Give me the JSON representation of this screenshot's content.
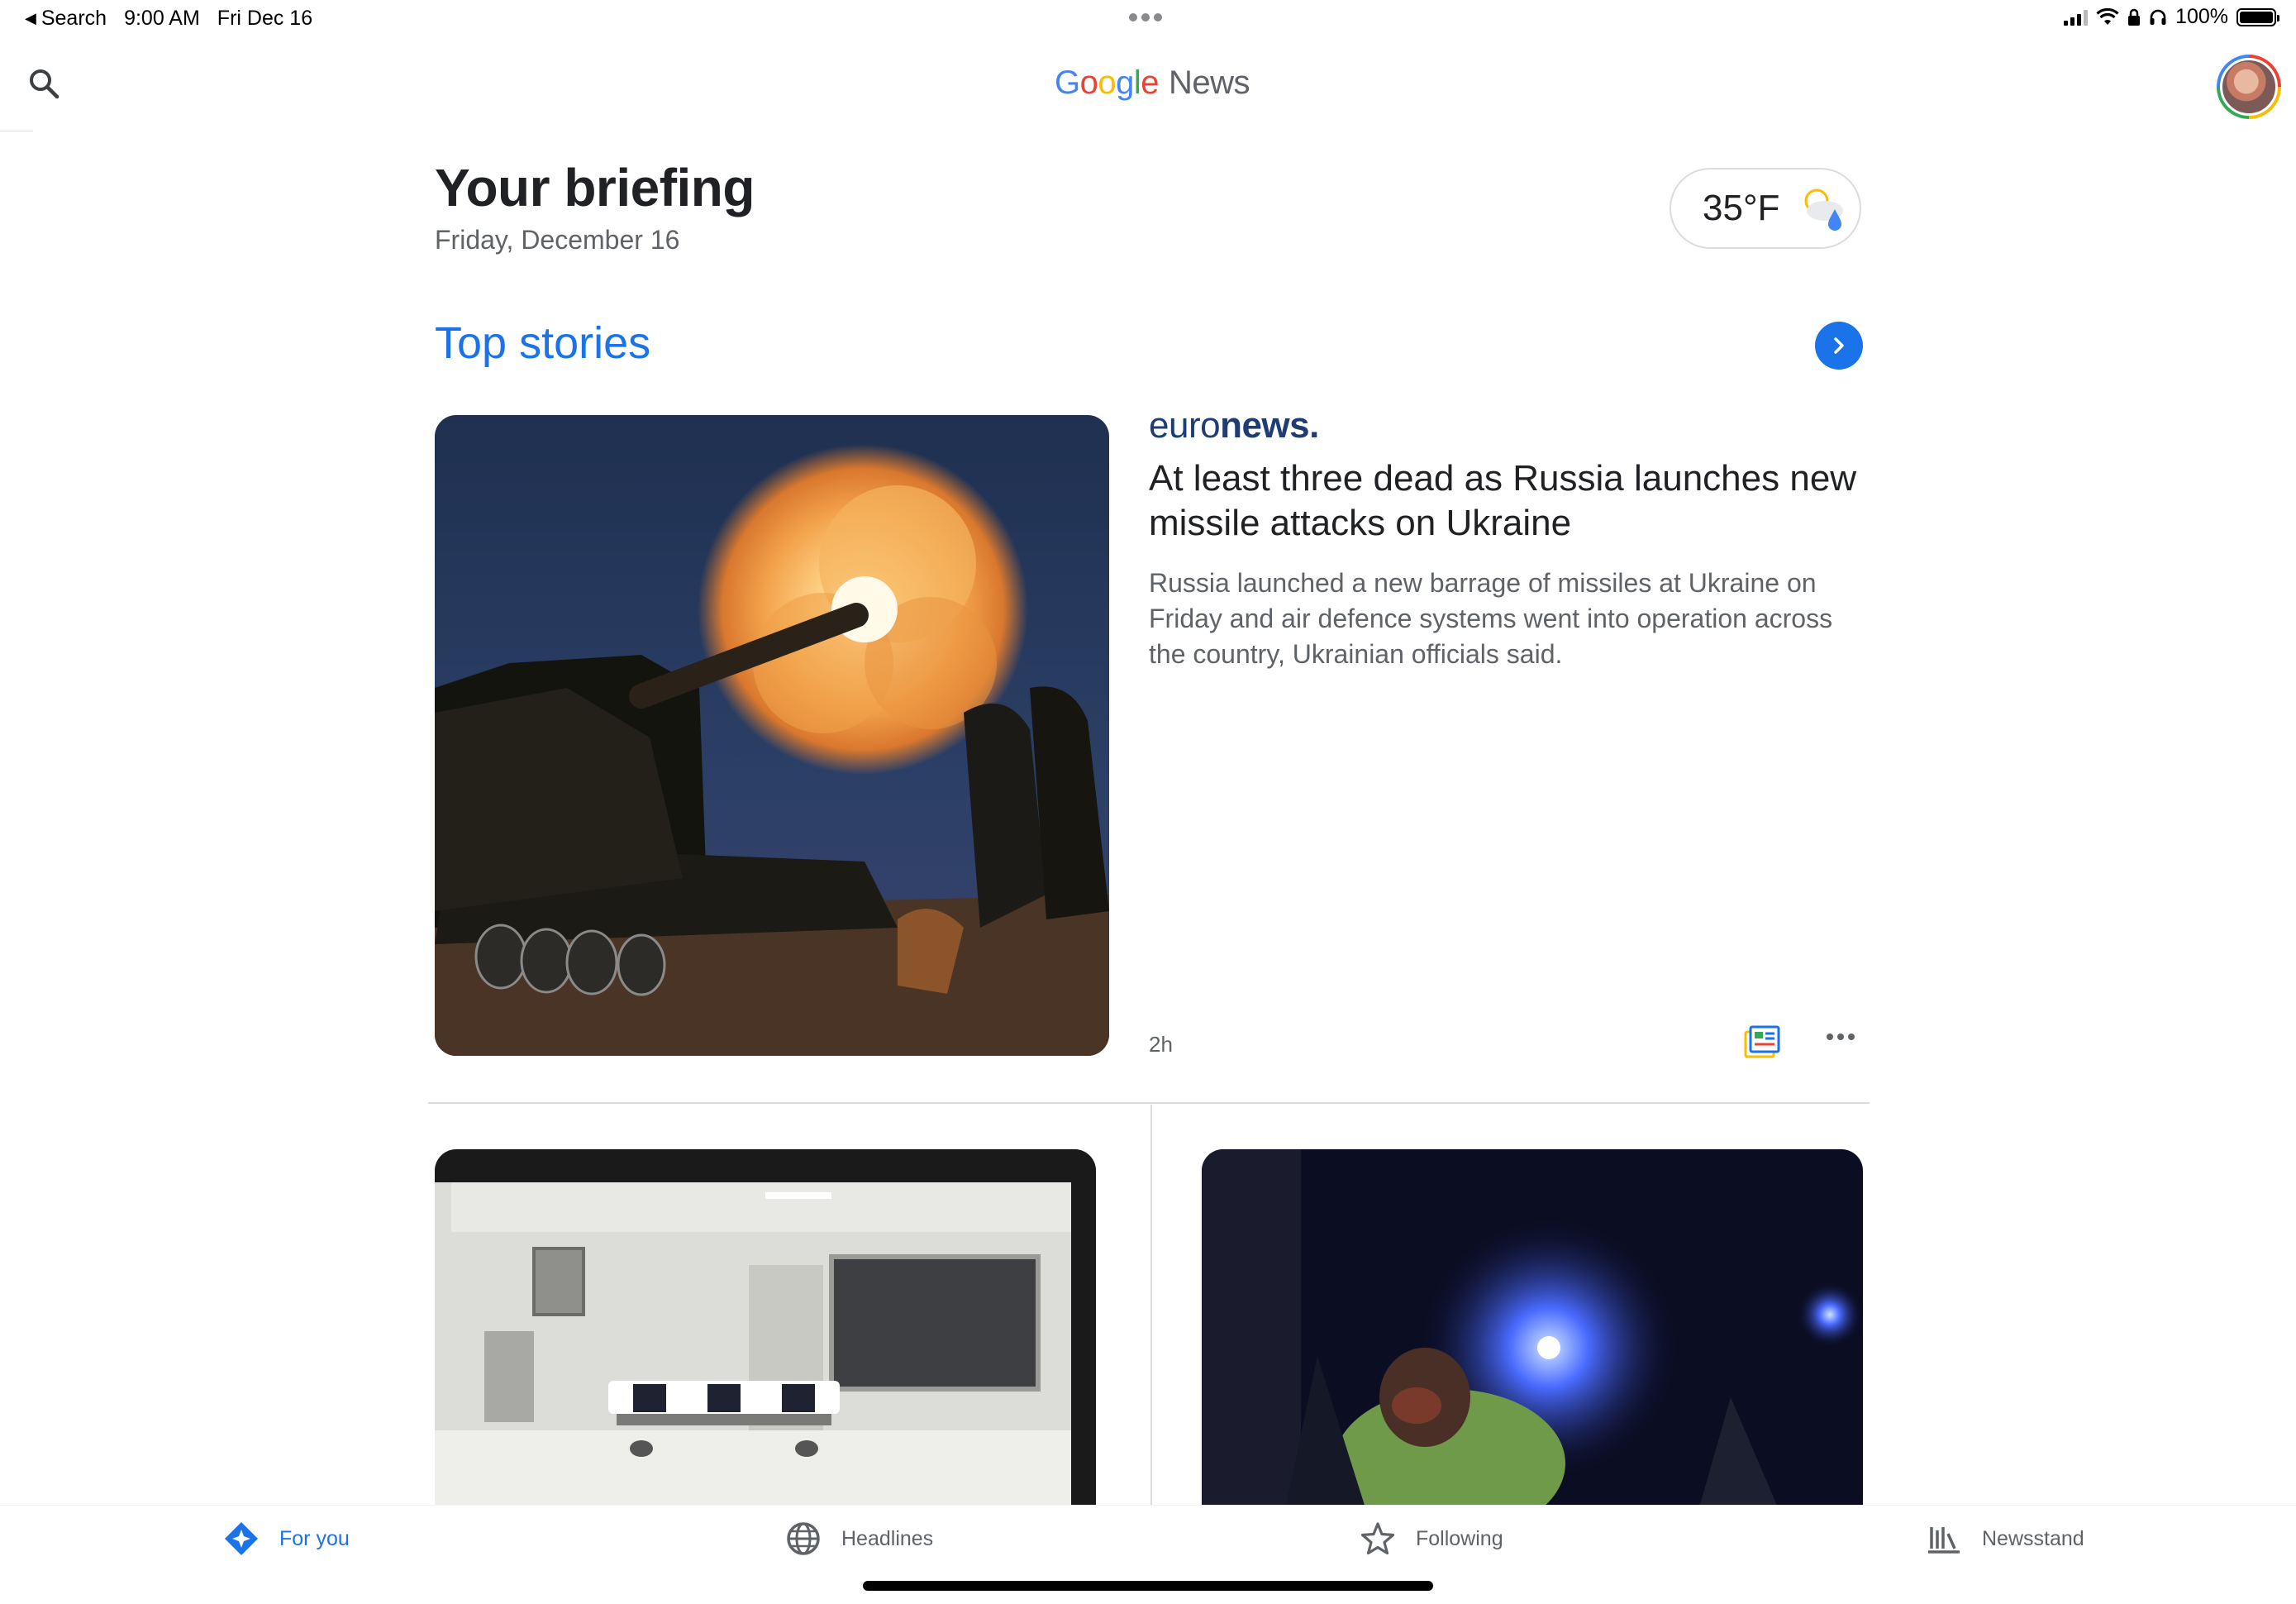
{
  "status_bar": {
    "back_label": "Search",
    "time": "9:00 AM",
    "date": "Fri Dec 16",
    "battery": "100%"
  },
  "header": {
    "logo_word": "Google",
    "logo_suffix": "News"
  },
  "briefing": {
    "title": "Your briefing",
    "date": "Friday, December 16",
    "weather_temp": "35°F"
  },
  "top_stories": {
    "title": "Top stories",
    "hero": {
      "source_light": "euro",
      "source_bold": "news.",
      "headline": "At least three dead as Russia launches new missile attacks on Ukraine",
      "summary": "Russia launched a new barrage of missiles at Ukraine on Friday and air defence systems went into operation across the country, Ukrainian officials said.",
      "time": "2h"
    }
  },
  "bottom_nav": {
    "items": [
      {
        "label": "For you",
        "icon": "for-you-icon",
        "active": true
      },
      {
        "label": "Headlines",
        "icon": "globe-icon",
        "active": false
      },
      {
        "label": "Following",
        "icon": "star-icon",
        "active": false
      },
      {
        "label": "Newsstand",
        "icon": "newsstand-icon",
        "active": false
      }
    ]
  },
  "colors": {
    "accent": "#1a73e8",
    "text_primary": "#202124",
    "text_secondary": "#5f6368",
    "euronews": "#1f3d73"
  }
}
